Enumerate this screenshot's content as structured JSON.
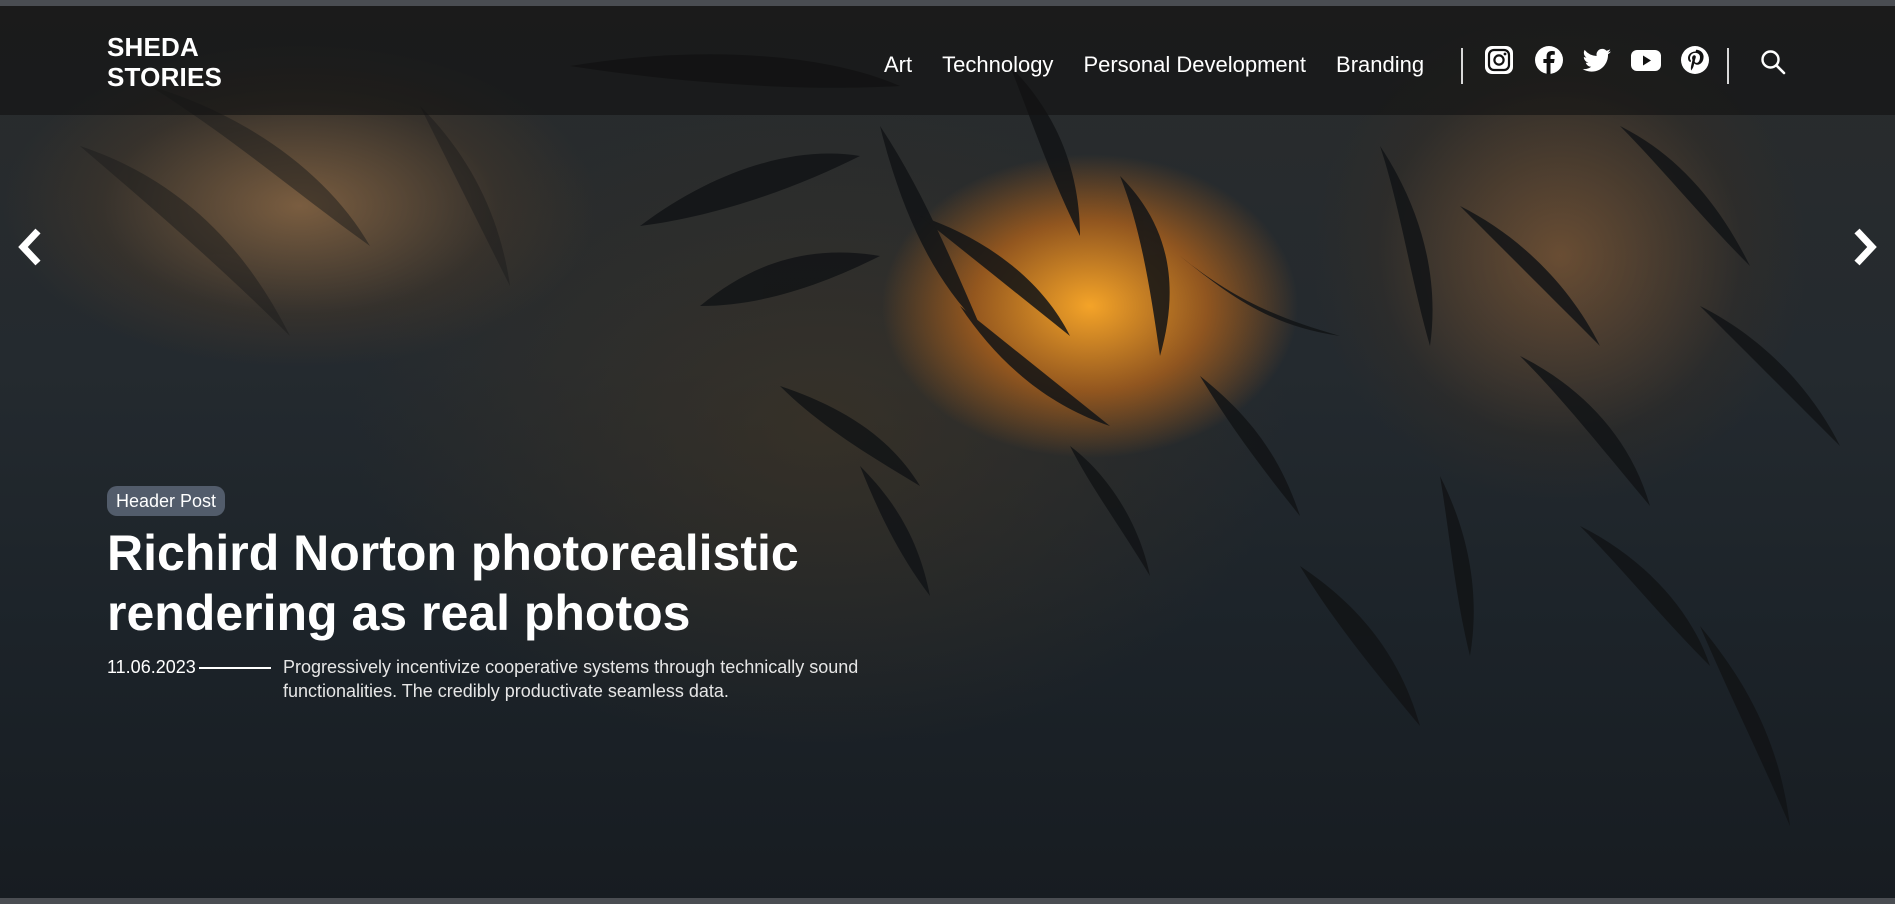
{
  "brand": {
    "line1": "SHEDA",
    "line2": "STORIES"
  },
  "nav": {
    "items": [
      {
        "label": "Art"
      },
      {
        "label": "Technology"
      },
      {
        "label": "Personal Development"
      },
      {
        "label": "Branding"
      }
    ]
  },
  "social": {
    "icons": [
      "instagram-icon",
      "facebook-icon",
      "twitter-icon",
      "youtube-icon",
      "pinterest-icon"
    ],
    "search_icon": "search-icon"
  },
  "slider": {
    "prev_icon": "chevron-left-icon",
    "next_icon": "chevron-right-icon"
  },
  "post": {
    "tag": "Header Post",
    "title_line1": "Richird Norton photorealistic",
    "title_line2": "rendering as real photos",
    "date": "11.06.2023",
    "excerpt_line1": "Progressively incentivize cooperative systems through technically sound",
    "excerpt_line2": "functionalities. The credibly productivate seamless data."
  },
  "colors": {
    "tag_background": "#525c6b",
    "header_overlay": "rgba(18,18,18,0.62)",
    "glow": "#ffaa28"
  }
}
